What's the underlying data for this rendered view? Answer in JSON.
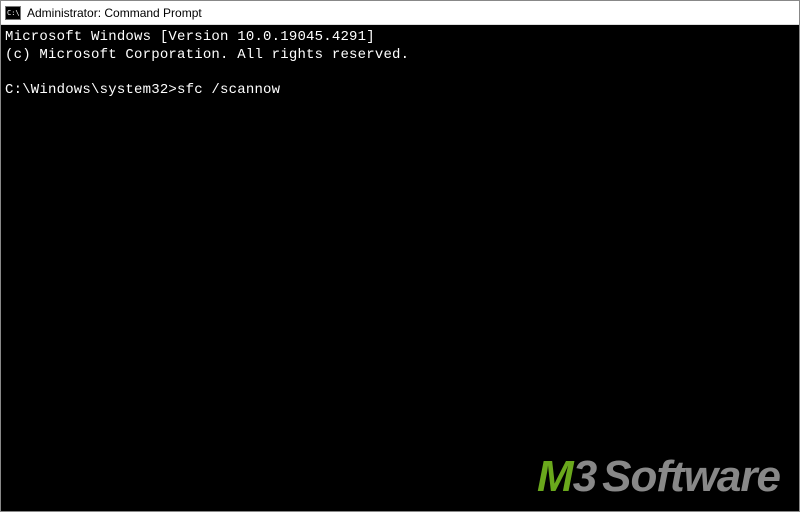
{
  "window": {
    "title": "Administrator: Command Prompt"
  },
  "terminal": {
    "lines": [
      "Microsoft Windows [Version 10.0.19045.4291]",
      "(c) Microsoft Corporation. All rights reserved.",
      "",
      ""
    ],
    "prompt": "C:\\Windows\\system32>",
    "command": "sfc /scannow"
  },
  "watermark": {
    "m": "M",
    "three": "3",
    "software": "Software"
  }
}
